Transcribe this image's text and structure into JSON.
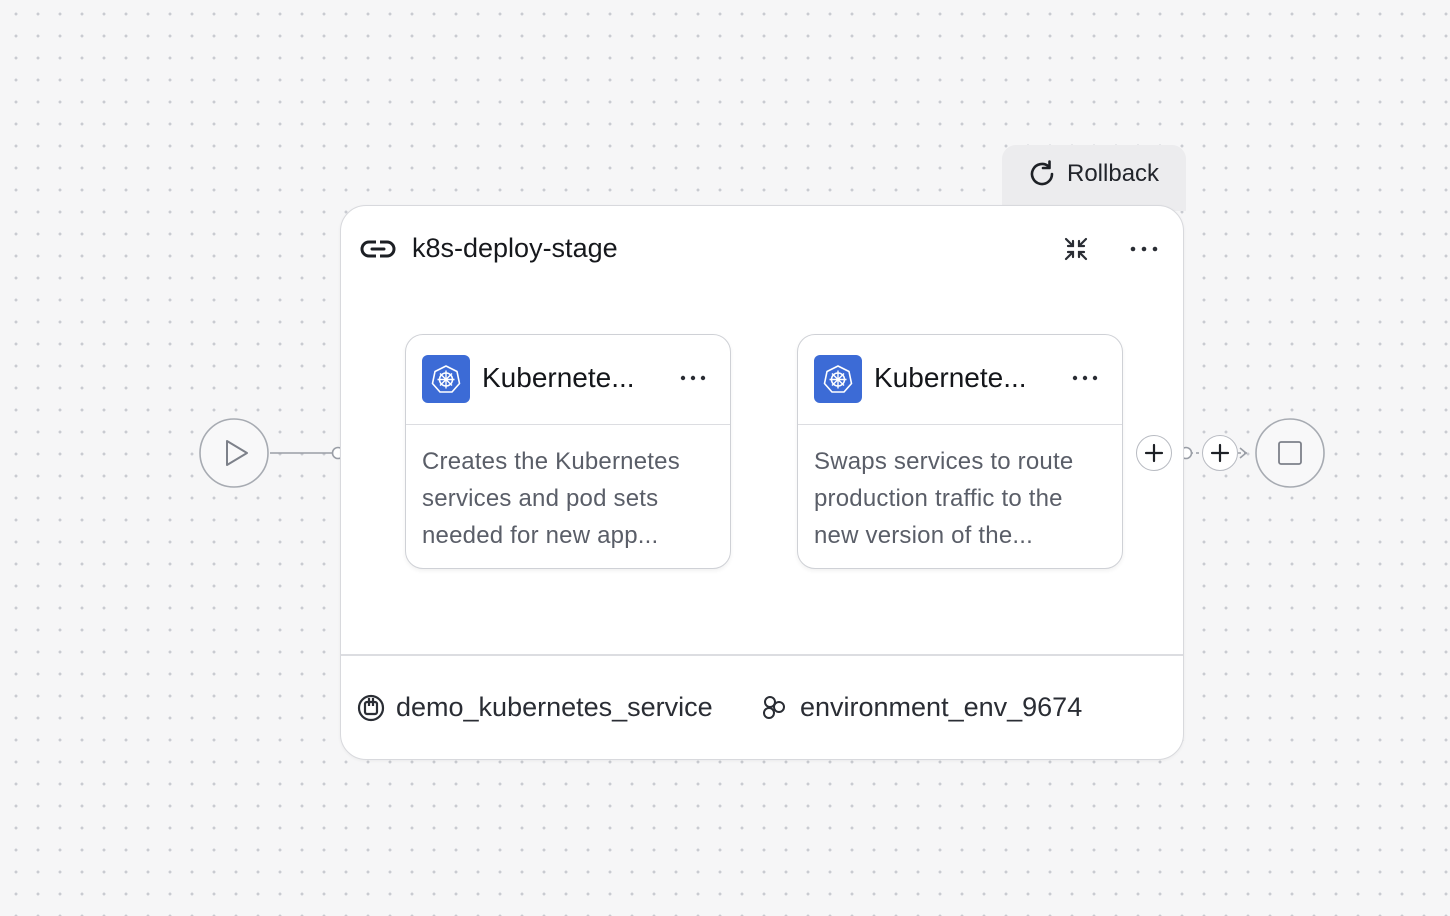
{
  "rollback": {
    "label": "Rollback"
  },
  "stage": {
    "title": "k8s-deploy-stage",
    "service": "demo_kubernetes_service",
    "environment": "environment_env_9674"
  },
  "steps": [
    {
      "title": "Kubernete...",
      "description_lines": [
        "Creates the Kubernetes",
        "services and pod sets",
        "needed for new app..."
      ]
    },
    {
      "title": "Kubernete...",
      "description_lines": [
        "Swaps services to route",
        "production traffic to the",
        "new version of the..."
      ]
    }
  ],
  "icons": {
    "start": "play-icon",
    "end": "stop-icon",
    "rollback": "refresh-icon",
    "stage": "link-icon",
    "collapse": "collapse-icon",
    "more": "more-horizontal-icon",
    "step": "kubernetes-icon",
    "service": "service-icon",
    "environment": "environment-icon",
    "add": "plus-icon"
  },
  "colors": {
    "kubernetes_badge": "#3c6bd6",
    "canvas": "#f6f6f7",
    "card": "#ffffff"
  }
}
